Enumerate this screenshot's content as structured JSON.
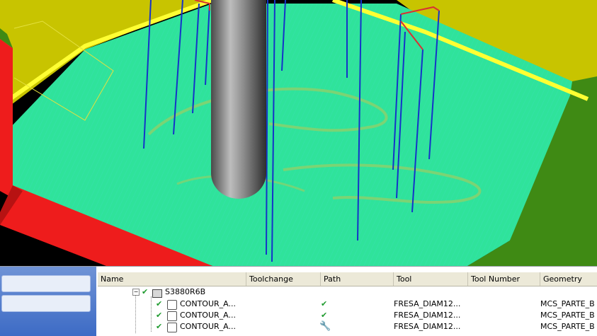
{
  "operation_navigator": {
    "columns": [
      "Name",
      "Toolchange",
      "Path",
      "Tool",
      "Tool Number",
      "Geometry"
    ],
    "group": {
      "name": "S3880R6B",
      "status": "check-icon"
    },
    "rows": [
      {
        "name": "CONTOUR_A...",
        "path_status": "check-icon",
        "tool": "FRESA_DIAM12...",
        "geometry": "MCS_PARTE_B"
      },
      {
        "name": "CONTOUR_A...",
        "path_status": "check-icon",
        "tool": "FRESA_DIAM12...",
        "geometry": "MCS_PARTE_B"
      },
      {
        "name": "CONTOUR_A...",
        "path_status": "wrench-icon",
        "tool": "FRESA_DIAM12...",
        "geometry": "MCS_PARTE_B"
      }
    ]
  },
  "graphics": {
    "colors": {
      "floor": "#2fe39b",
      "mold_yellow": "#c8c400",
      "rim": "#ffff33",
      "wall_green": "#3f8a14",
      "stock_red": "#ee1c1c",
      "toolpath_blue": "#1533c9",
      "tool_gray": "#8b8b8b"
    }
  }
}
